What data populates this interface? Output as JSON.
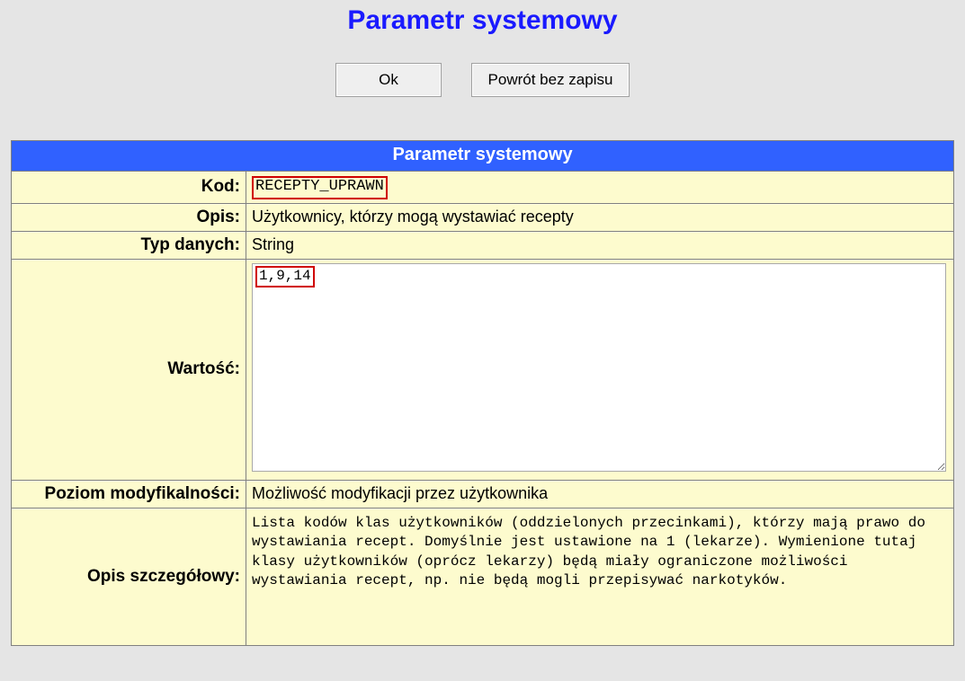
{
  "page_title": "Parametr systemowy",
  "buttons": {
    "ok": "Ok",
    "return": "Powrót bez zapisu"
  },
  "table": {
    "caption": "Parametr systemowy",
    "rows": {
      "kod": {
        "label": "Kod:",
        "value": "RECEPTY_UPRAWN"
      },
      "opis": {
        "label": "Opis:",
        "value": "Użytkownicy, którzy mogą wystawiać recepty"
      },
      "typ": {
        "label": "Typ danych:",
        "value": "String"
      },
      "wartosc": {
        "label": "Wartość:",
        "value": "1,9,14"
      },
      "poziom": {
        "label": "Poziom modyfikalności:",
        "value": "Możliwość modyfikacji przez użytkownika"
      },
      "szczegoly": {
        "label": "Opis szczegółowy:",
        "value": "Lista kodów klas użytkowników (oddzielonych przecinkami), którzy mają prawo do wystawiania recept. Domyślnie jest ustawione na 1 (lekarze). Wymienione tutaj klasy użytkowników (oprócz lekarzy) będą miały ograniczone możliwości wystawiania recept, np. nie będą mogli przepisywać narkotyków."
      }
    }
  }
}
